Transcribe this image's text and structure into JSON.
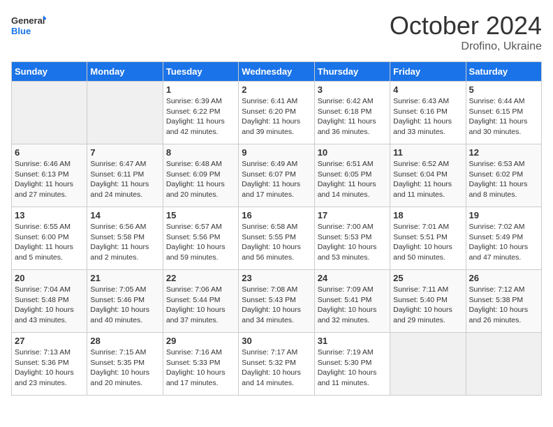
{
  "header": {
    "logo_general": "General",
    "logo_blue": "Blue",
    "month": "October 2024",
    "location": "Drofino, Ukraine"
  },
  "weekdays": [
    "Sunday",
    "Monday",
    "Tuesday",
    "Wednesday",
    "Thursday",
    "Friday",
    "Saturday"
  ],
  "weeks": [
    [
      {
        "day": "",
        "sunrise": "",
        "sunset": "",
        "daylight": ""
      },
      {
        "day": "",
        "sunrise": "",
        "sunset": "",
        "daylight": ""
      },
      {
        "day": "1",
        "sunrise": "Sunrise: 6:39 AM",
        "sunset": "Sunset: 6:22 PM",
        "daylight": "Daylight: 11 hours and 42 minutes."
      },
      {
        "day": "2",
        "sunrise": "Sunrise: 6:41 AM",
        "sunset": "Sunset: 6:20 PM",
        "daylight": "Daylight: 11 hours and 39 minutes."
      },
      {
        "day": "3",
        "sunrise": "Sunrise: 6:42 AM",
        "sunset": "Sunset: 6:18 PM",
        "daylight": "Daylight: 11 hours and 36 minutes."
      },
      {
        "day": "4",
        "sunrise": "Sunrise: 6:43 AM",
        "sunset": "Sunset: 6:16 PM",
        "daylight": "Daylight: 11 hours and 33 minutes."
      },
      {
        "day": "5",
        "sunrise": "Sunrise: 6:44 AM",
        "sunset": "Sunset: 6:15 PM",
        "daylight": "Daylight: 11 hours and 30 minutes."
      }
    ],
    [
      {
        "day": "6",
        "sunrise": "Sunrise: 6:46 AM",
        "sunset": "Sunset: 6:13 PM",
        "daylight": "Daylight: 11 hours and 27 minutes."
      },
      {
        "day": "7",
        "sunrise": "Sunrise: 6:47 AM",
        "sunset": "Sunset: 6:11 PM",
        "daylight": "Daylight: 11 hours and 24 minutes."
      },
      {
        "day": "8",
        "sunrise": "Sunrise: 6:48 AM",
        "sunset": "Sunset: 6:09 PM",
        "daylight": "Daylight: 11 hours and 20 minutes."
      },
      {
        "day": "9",
        "sunrise": "Sunrise: 6:49 AM",
        "sunset": "Sunset: 6:07 PM",
        "daylight": "Daylight: 11 hours and 17 minutes."
      },
      {
        "day": "10",
        "sunrise": "Sunrise: 6:51 AM",
        "sunset": "Sunset: 6:05 PM",
        "daylight": "Daylight: 11 hours and 14 minutes."
      },
      {
        "day": "11",
        "sunrise": "Sunrise: 6:52 AM",
        "sunset": "Sunset: 6:04 PM",
        "daylight": "Daylight: 11 hours and 11 minutes."
      },
      {
        "day": "12",
        "sunrise": "Sunrise: 6:53 AM",
        "sunset": "Sunset: 6:02 PM",
        "daylight": "Daylight: 11 hours and 8 minutes."
      }
    ],
    [
      {
        "day": "13",
        "sunrise": "Sunrise: 6:55 AM",
        "sunset": "Sunset: 6:00 PM",
        "daylight": "Daylight: 11 hours and 5 minutes."
      },
      {
        "day": "14",
        "sunrise": "Sunrise: 6:56 AM",
        "sunset": "Sunset: 5:58 PM",
        "daylight": "Daylight: 11 hours and 2 minutes."
      },
      {
        "day": "15",
        "sunrise": "Sunrise: 6:57 AM",
        "sunset": "Sunset: 5:56 PM",
        "daylight": "Daylight: 10 hours and 59 minutes."
      },
      {
        "day": "16",
        "sunrise": "Sunrise: 6:58 AM",
        "sunset": "Sunset: 5:55 PM",
        "daylight": "Daylight: 10 hours and 56 minutes."
      },
      {
        "day": "17",
        "sunrise": "Sunrise: 7:00 AM",
        "sunset": "Sunset: 5:53 PM",
        "daylight": "Daylight: 10 hours and 53 minutes."
      },
      {
        "day": "18",
        "sunrise": "Sunrise: 7:01 AM",
        "sunset": "Sunset: 5:51 PM",
        "daylight": "Daylight: 10 hours and 50 minutes."
      },
      {
        "day": "19",
        "sunrise": "Sunrise: 7:02 AM",
        "sunset": "Sunset: 5:49 PM",
        "daylight": "Daylight: 10 hours and 47 minutes."
      }
    ],
    [
      {
        "day": "20",
        "sunrise": "Sunrise: 7:04 AM",
        "sunset": "Sunset: 5:48 PM",
        "daylight": "Daylight: 10 hours and 43 minutes."
      },
      {
        "day": "21",
        "sunrise": "Sunrise: 7:05 AM",
        "sunset": "Sunset: 5:46 PM",
        "daylight": "Daylight: 10 hours and 40 minutes."
      },
      {
        "day": "22",
        "sunrise": "Sunrise: 7:06 AM",
        "sunset": "Sunset: 5:44 PM",
        "daylight": "Daylight: 10 hours and 37 minutes."
      },
      {
        "day": "23",
        "sunrise": "Sunrise: 7:08 AM",
        "sunset": "Sunset: 5:43 PM",
        "daylight": "Daylight: 10 hours and 34 minutes."
      },
      {
        "day": "24",
        "sunrise": "Sunrise: 7:09 AM",
        "sunset": "Sunset: 5:41 PM",
        "daylight": "Daylight: 10 hours and 32 minutes."
      },
      {
        "day": "25",
        "sunrise": "Sunrise: 7:11 AM",
        "sunset": "Sunset: 5:40 PM",
        "daylight": "Daylight: 10 hours and 29 minutes."
      },
      {
        "day": "26",
        "sunrise": "Sunrise: 7:12 AM",
        "sunset": "Sunset: 5:38 PM",
        "daylight": "Daylight: 10 hours and 26 minutes."
      }
    ],
    [
      {
        "day": "27",
        "sunrise": "Sunrise: 7:13 AM",
        "sunset": "Sunset: 5:36 PM",
        "daylight": "Daylight: 10 hours and 23 minutes."
      },
      {
        "day": "28",
        "sunrise": "Sunrise: 7:15 AM",
        "sunset": "Sunset: 5:35 PM",
        "daylight": "Daylight: 10 hours and 20 minutes."
      },
      {
        "day": "29",
        "sunrise": "Sunrise: 7:16 AM",
        "sunset": "Sunset: 5:33 PM",
        "daylight": "Daylight: 10 hours and 17 minutes."
      },
      {
        "day": "30",
        "sunrise": "Sunrise: 7:17 AM",
        "sunset": "Sunset: 5:32 PM",
        "daylight": "Daylight: 10 hours and 14 minutes."
      },
      {
        "day": "31",
        "sunrise": "Sunrise: 7:19 AM",
        "sunset": "Sunset: 5:30 PM",
        "daylight": "Daylight: 10 hours and 11 minutes."
      },
      {
        "day": "",
        "sunrise": "",
        "sunset": "",
        "daylight": ""
      },
      {
        "day": "",
        "sunrise": "",
        "sunset": "",
        "daylight": ""
      }
    ]
  ]
}
